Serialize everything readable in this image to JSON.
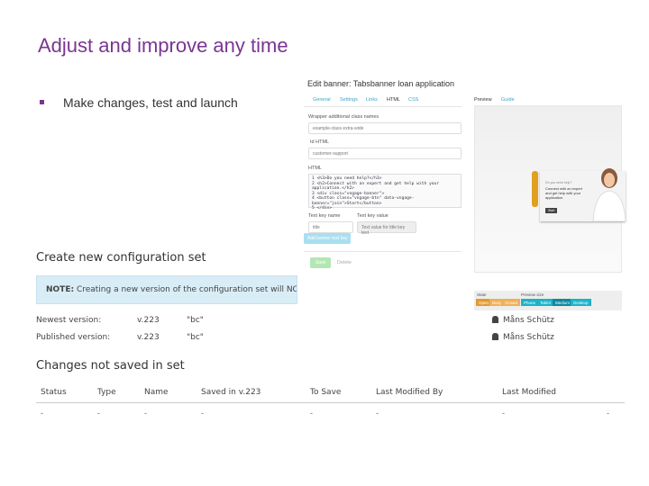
{
  "slide": {
    "title": "Adjust and improve any time",
    "bullet": "Make changes, test and launch"
  },
  "config": {
    "title": "Create new configuration set",
    "note_bold": "NOTE:",
    "note_text": " Creating a new version of the configuration set will NOT autom",
    "versions": [
      {
        "label": "Newest version:",
        "version": "v.223",
        "name": "\"bc\"",
        "user": "Måns Schütz"
      },
      {
        "label": "Published version:",
        "version": "v.223",
        "name": "\"bc\"",
        "user": "Måns Schütz"
      }
    ],
    "changes_title": "Changes not saved in set",
    "columns": [
      "Status",
      "Type",
      "Name",
      "Saved in v.223",
      "To Save",
      "Last Modified By",
      "Last Modified"
    ],
    "empty_cell": "-"
  },
  "edit": {
    "title": "Edit banner: Tabsbanner loan application",
    "tabs": [
      "General",
      "Settings",
      "Links",
      "HTML",
      "CSS"
    ],
    "wrapper_label": "Wrapper additional class names",
    "wrapper_value": "example-class extra-wide",
    "id_label": "Id HTML",
    "id_value": "customer-support",
    "html_label": "HTML",
    "code": [
      "1 <h3>Do you need help?</h3>",
      "2 <h2>Connect with an expert and get help with your",
      "  application.</h2>",
      "3 <div class=\"vngage-banner\">",
      "4   <button class=\"vngage-btn\" data-vngage-",
      "  banner=\"join\">Start</button>",
      "5 </div>"
    ],
    "key_name_label": "Text key name",
    "key_name_value": "title",
    "key_value_label": "Text key value",
    "key_value_placeholder": "Text value for title key text",
    "add_key": "Add banner text key",
    "save": "Save",
    "delete": "Delete"
  },
  "preview": {
    "tabs": [
      "Preview",
      "Guide"
    ],
    "banner_heading": "Do you need help?",
    "banner_text": "Connect with an expert and get help with your application.",
    "banner_button": "Start",
    "state_label": "State",
    "states": [
      "Open",
      "Busy",
      "Closed"
    ],
    "size_label": "Preview size",
    "sizes": [
      "Phone",
      "Tablet",
      "Medium",
      "Desktop"
    ],
    "colors": {
      "orange": "#e39a2e",
      "teal": "#1bb3c9",
      "teal_active": "#0e8a9c"
    }
  }
}
